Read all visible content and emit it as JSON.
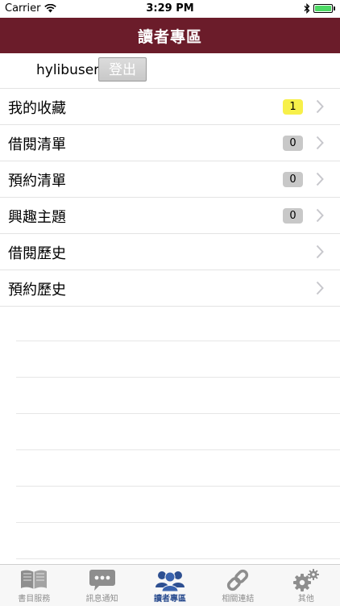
{
  "status_bar": {
    "carrier": "Carrier",
    "time": "3:29 PM",
    "battery_level": 1.0
  },
  "nav": {
    "title": "讀者專區"
  },
  "user": {
    "name": "hylibuser",
    "logout_label": "登出"
  },
  "items": [
    {
      "label": "我的收藏",
      "badge": "1",
      "badge_color": "#f7f04a"
    },
    {
      "label": "借閱清單",
      "badge": "0",
      "badge_color": "#c8c8c8"
    },
    {
      "label": "預約清單",
      "badge": "0",
      "badge_color": "#c8c8c8"
    },
    {
      "label": "興趣主題",
      "badge": "0",
      "badge_color": "#c8c8c8"
    },
    {
      "label": "借閱歷史"
    },
    {
      "label": "預約歷史"
    }
  ],
  "tabs": [
    {
      "label": "書目服務",
      "icon": "book-icon"
    },
    {
      "label": "訊息通知",
      "icon": "chat-bubble-icon"
    },
    {
      "label": "讀者專區",
      "icon": "people-icon",
      "active": true
    },
    {
      "label": "相關連結",
      "icon": "link-icon"
    },
    {
      "label": "其他",
      "icon": "gear-icon"
    }
  ],
  "colors": {
    "nav_background": "#6b1c2a",
    "active_tab": "#2d4f91",
    "inactive_tab": "#8e8e8e"
  }
}
